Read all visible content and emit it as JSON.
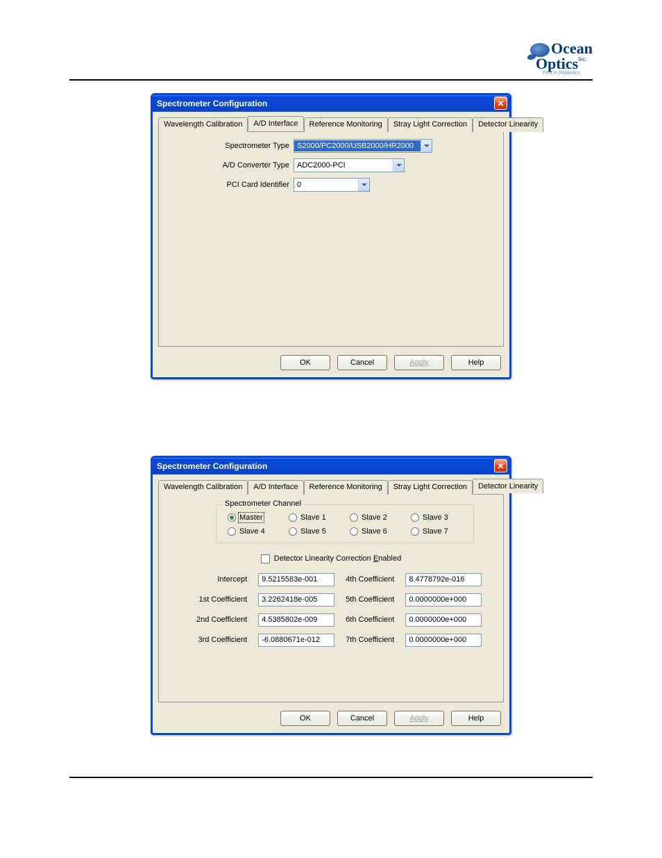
{
  "logo": {
    "line1": "Ocean",
    "line2": "Optics",
    "suffix": "Inc.",
    "tagline": "First in Photonics"
  },
  "dialog1": {
    "title": "Spectrometer Configuration",
    "tabs": [
      "Wavelength Calibration",
      "A/D Interface",
      "Reference Monitoring",
      "Stray Light Correction",
      "Detector Linearity"
    ],
    "active_tab": 1,
    "fields": {
      "spectrometer_type": {
        "label": "Spectrometer Type",
        "value": "S2000/PC2000/USB2000/HR2000"
      },
      "ad_converter_type": {
        "label": "A/D Converter Type",
        "value": "ADC2000-PCI"
      },
      "pci_card_identifier": {
        "label": "PCI Card Identifier",
        "value": "0"
      }
    },
    "buttons": {
      "ok": "OK",
      "cancel": "Cancel",
      "apply": "Apply",
      "help": "Help"
    }
  },
  "dialog2": {
    "title": "Spectrometer Configuration",
    "tabs": [
      "Wavelength Calibration",
      "A/D Interface",
      "Reference Monitoring",
      "Stray Light Correction",
      "Detector Linearity"
    ],
    "active_tab": 4,
    "channel_group": {
      "legend": "Spectrometer Channel",
      "options": [
        "Master",
        "Slave 1",
        "Slave 2",
        "Slave 3",
        "Slave 4",
        "Slave 5",
        "Slave 6",
        "Slave 7"
      ],
      "selected": 0
    },
    "enable_checkbox": {
      "label_pre": "Detector Linearity Correction ",
      "label_ul": "E",
      "label_post": "nabled",
      "checked": false
    },
    "coefficients": [
      {
        "label": "Intercept",
        "value": "9.5215583e-001"
      },
      {
        "label": "1st Coefficient",
        "value": "3.2262418e-005"
      },
      {
        "label": "2nd Coefficient",
        "value": "4.5385802e-009"
      },
      {
        "label": "3rd Coefficient",
        "value": "-6.0880671e-012"
      },
      {
        "label": "4th Coefficient",
        "value": "8.4778792e-016"
      },
      {
        "label": "5th Coefficient",
        "value": "0.0000000e+000"
      },
      {
        "label": "6th Coefficient",
        "value": "0.0000000e+000"
      },
      {
        "label": "7th Coefficient",
        "value": "0.0000000e+000"
      }
    ],
    "buttons": {
      "ok": "OK",
      "cancel": "Cancel",
      "apply": "Apply",
      "help": "Help"
    }
  }
}
